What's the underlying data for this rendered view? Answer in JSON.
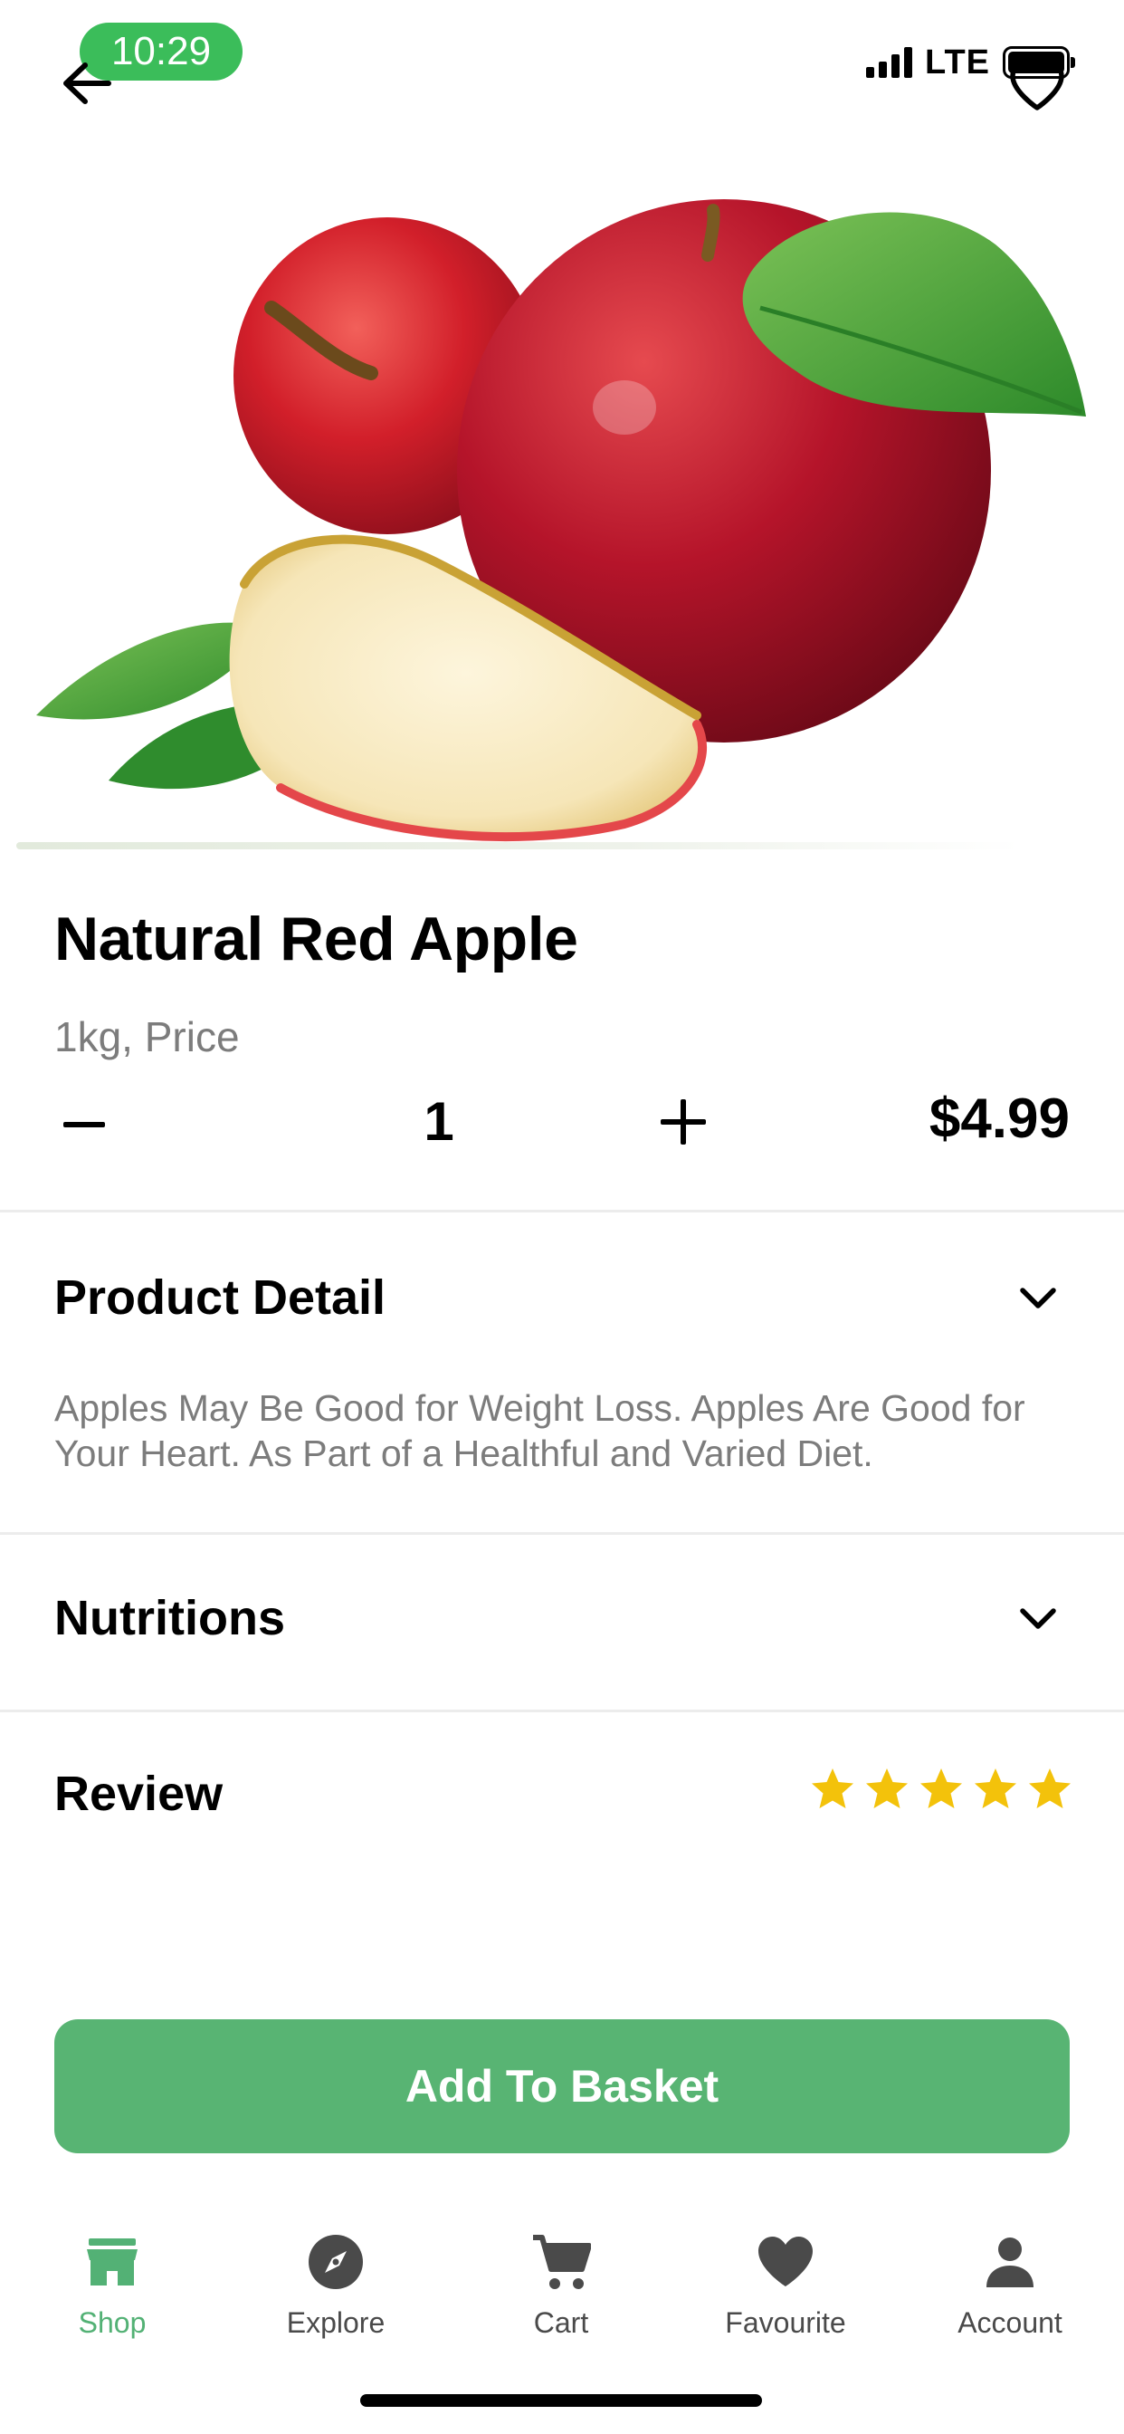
{
  "status_bar": {
    "time": "10:29",
    "network": "LTE"
  },
  "product": {
    "name": "Natural Red Apple",
    "unit_label": "1kg, Price",
    "quantity": "1",
    "price": "$4.99",
    "rating": 5,
    "rating_max": 5
  },
  "sections": {
    "detail_title": "Product Detail",
    "detail_text": "Apples May Be Good for Weight Loss. Apples Are Good for Your Heart. As Part of a Healthful and Varied Diet.",
    "nutritions_title": "Nutritions",
    "review_title": "Review"
  },
  "actions": {
    "add_to_basket": "Add To Basket"
  },
  "tabbar": {
    "items": [
      {
        "label": "Shop",
        "icon": "store-icon",
        "active": true
      },
      {
        "label": "Explore",
        "icon": "compass-icon",
        "active": false
      },
      {
        "label": "Cart",
        "icon": "cart-icon",
        "active": false
      },
      {
        "label": "Favourite",
        "icon": "heart-icon",
        "active": false
      },
      {
        "label": "Account",
        "icon": "person-icon",
        "active": false
      }
    ]
  },
  "colors": {
    "accent": "#53B175",
    "button": "#58B473",
    "time_pill": "#3BBD5A",
    "star": "#F3C20B",
    "muted_text": "#7C7C7C"
  }
}
